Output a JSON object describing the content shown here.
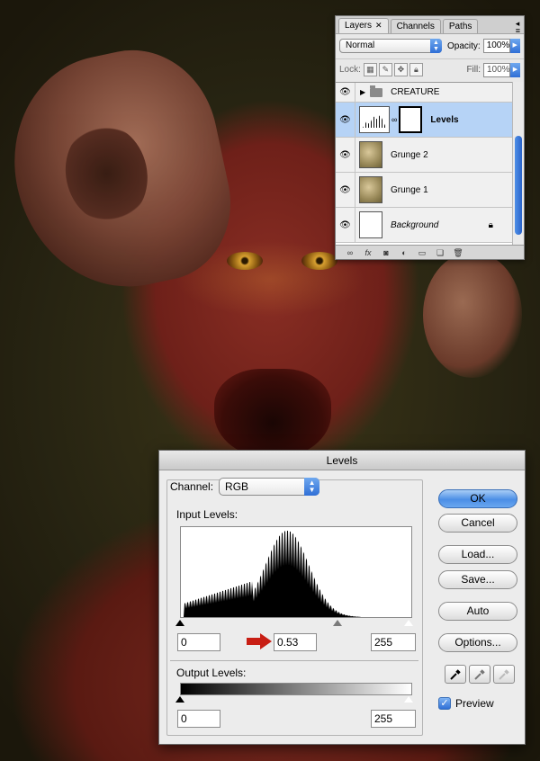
{
  "layers_panel": {
    "tabs": [
      {
        "label": "Layers",
        "active": true
      },
      {
        "label": "Channels",
        "active": false
      },
      {
        "label": "Paths",
        "active": false
      }
    ],
    "blend_mode": "Normal",
    "opacity_label": "Opacity:",
    "opacity_value": "100%",
    "lock_label": "Lock:",
    "fill_label": "Fill:",
    "fill_value": "100%",
    "layers": [
      {
        "name": "CREATURE",
        "type": "group",
        "visible": true
      },
      {
        "name": "Levels",
        "type": "adjustment",
        "visible": true,
        "selected": true
      },
      {
        "name": "Grunge 2",
        "type": "image",
        "visible": true
      },
      {
        "name": "Grunge 1",
        "type": "image",
        "visible": true
      },
      {
        "name": "Background",
        "type": "background",
        "visible": true,
        "locked": true
      }
    ]
  },
  "levels_dialog": {
    "title": "Levels",
    "channel_label": "Channel:",
    "channel_value": "RGB",
    "input_levels_label": "Input Levels:",
    "input_black": "0",
    "input_gamma": "0.53",
    "input_white": "255",
    "output_levels_label": "Output Levels:",
    "output_black": "0",
    "output_white": "255",
    "buttons": {
      "ok": "OK",
      "cancel": "Cancel",
      "load": "Load...",
      "save": "Save...",
      "auto": "Auto",
      "options": "Options..."
    },
    "preview_label": "Preview",
    "preview_checked": true
  },
  "colors": {
    "selection_blue": "#b6d3f6",
    "accent_blue": "#2f6fd6",
    "arrow_red": "#c81e14"
  }
}
